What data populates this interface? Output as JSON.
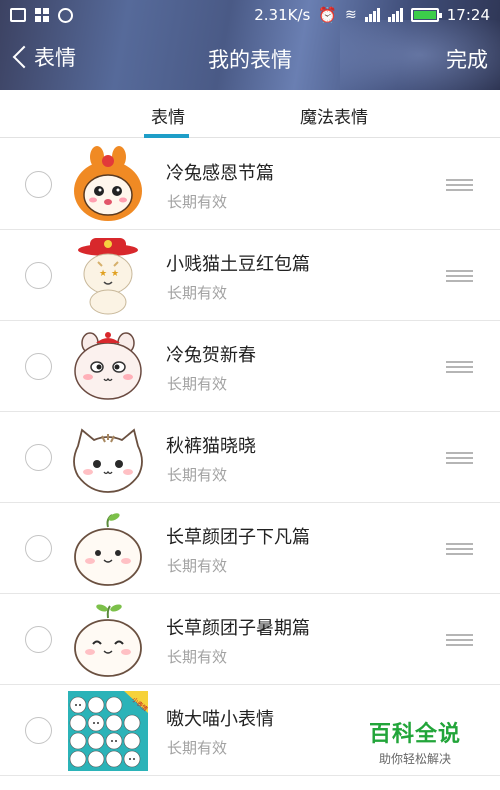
{
  "status_bar": {
    "speed": "2.31K/s",
    "time": "17:24"
  },
  "nav": {
    "back_label": "表情",
    "title": "我的表情",
    "done_label": "完成"
  },
  "tabs": [
    {
      "label": "表情",
      "active": true
    },
    {
      "label": "魔法表情",
      "active": false
    }
  ],
  "items": [
    {
      "name": "冷兔感恩节篇",
      "status": "长期有效"
    },
    {
      "name": "小贱猫土豆红包篇",
      "status": "长期有效"
    },
    {
      "name": "冷兔贺新春",
      "status": "长期有效"
    },
    {
      "name": "秋裤猫晓晓",
      "status": "长期有效"
    },
    {
      "name": "长草颜团子下凡篇",
      "status": "长期有效"
    },
    {
      "name": "长草颜团子暑期篇",
      "status": "长期有效"
    },
    {
      "name": "嗷大喵小表情",
      "status": "长期有效",
      "badge": "小表情"
    }
  ],
  "watermark": {
    "main": "百科全说",
    "sub": "助你轻松解决"
  },
  "colors": {
    "accent": "#1e9ec8",
    "battery": "#3ccd4a",
    "watermark": "#22a53a"
  }
}
